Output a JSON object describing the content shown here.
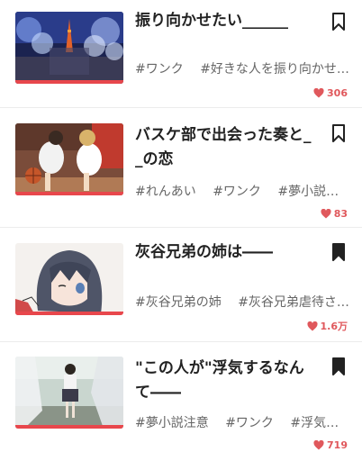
{
  "stories": [
    {
      "title": "振り向かせたい______",
      "tags": [
        "#ワンク",
        "#好きな人を振り向かせ…"
      ],
      "likes": "306",
      "bookmarked": false,
      "thumbnail": "night-illumination-tower"
    },
    {
      "title": "バスケ部で出会った奏と__の恋",
      "tags": [
        "#れんあい",
        "#ワンク",
        "#夢小説注意"
      ],
      "likes": "83",
      "bookmarked": false,
      "thumbnail": "basketball-players"
    },
    {
      "title": "灰谷兄弟の姉は――",
      "tags": [
        "#灰谷兄弟の姉",
        "#灰谷兄弟虐待さ…"
      ],
      "likes": "1.6万",
      "bookmarked": true,
      "thumbnail": "anime-girl-dark-hair"
    },
    {
      "title": "\"この人が\"浮気するなんて――",
      "tags": [
        "#夢小説注意",
        "#ワンク",
        "#浮気系"
      ],
      "likes": "719",
      "bookmarked": true,
      "thumbnail": "school-uniform-couple"
    }
  ],
  "colors": {
    "accent": "#e8474c",
    "heart": "#e0585c",
    "tag_text": "#666666"
  }
}
